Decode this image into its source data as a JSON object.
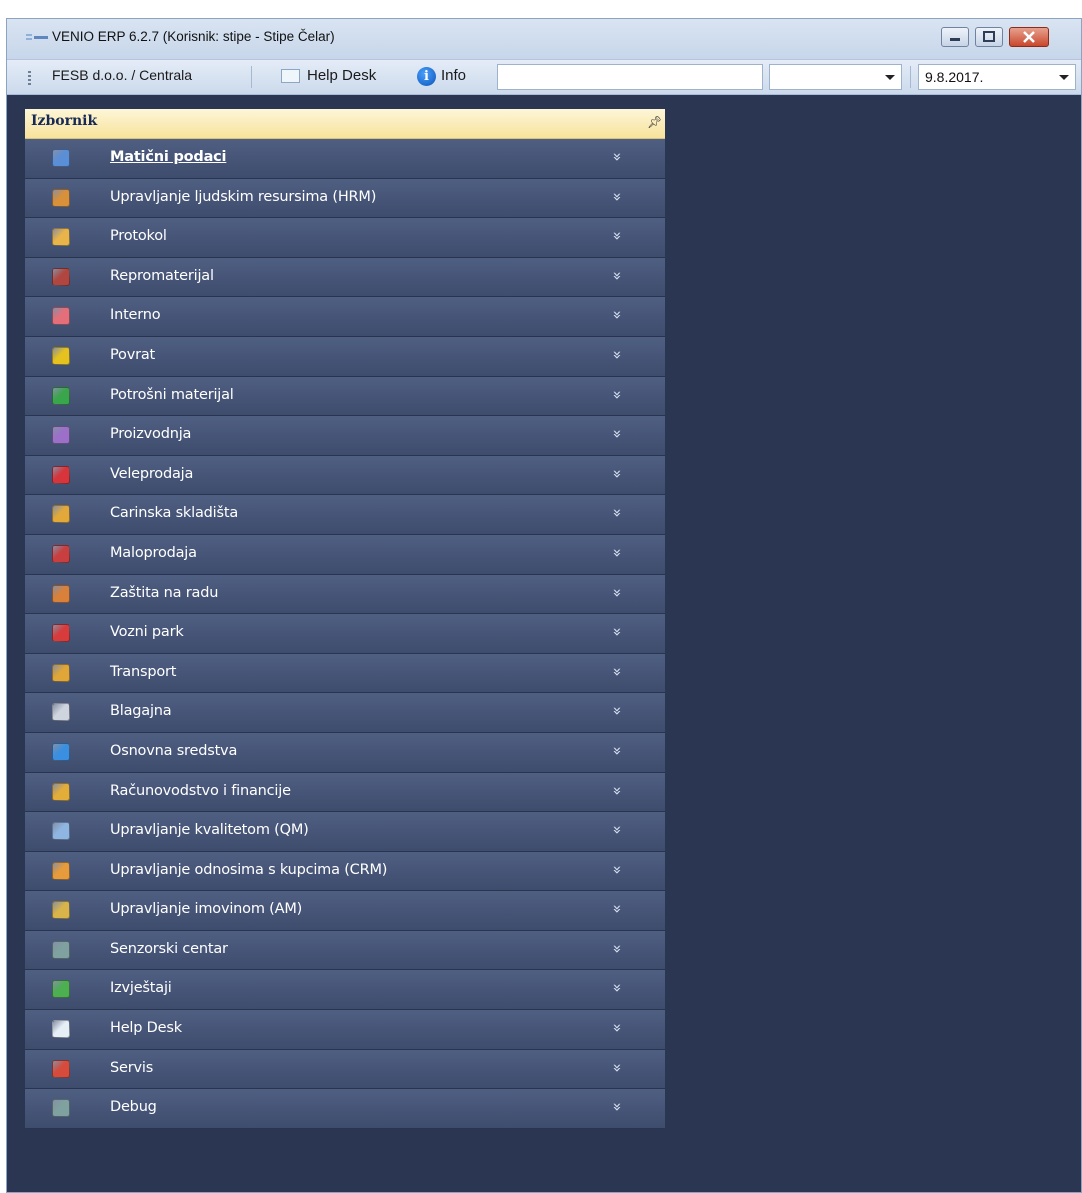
{
  "window": {
    "title": "VENIO ERP 6.2.7 (Korisnik: stipe - Stipe Čelar)"
  },
  "toolbar": {
    "company": "FESB d.o.o. / Centrala",
    "helpdesk_label": "Help Desk",
    "info_label": "Info",
    "search_value": "",
    "combo_value": "",
    "date_value": "9.8.2017."
  },
  "panel": {
    "title": "Izbornik",
    "items": [
      {
        "label": "Matični podaci",
        "icon": "database-icon",
        "color": "#5a8fd8"
      },
      {
        "label": "Upravljanje ljudskim resursima (HRM)",
        "icon": "person-icon",
        "color": "#d9903a"
      },
      {
        "label": "Protokol",
        "icon": "clipboard-icon",
        "color": "#e9b44a"
      },
      {
        "label": "Repromaterijal",
        "icon": "materials-icon",
        "color": "#b0463f"
      },
      {
        "label": "Interno",
        "icon": "document-icon",
        "color": "#e46f7a"
      },
      {
        "label": "Povrat",
        "icon": "radiation-icon",
        "color": "#e6c21f"
      },
      {
        "label": "Potrošni materijal",
        "icon": "share-icon",
        "color": "#3aa64b"
      },
      {
        "label": "Proizvodnja",
        "icon": "beaker-icon",
        "color": "#9c70c9"
      },
      {
        "label": "Veleprodaja",
        "icon": "store-icon",
        "color": "#d8343b"
      },
      {
        "label": "Carinska skladišta",
        "icon": "barrier-icon",
        "color": "#e2a93a"
      },
      {
        "label": "Maloprodaja",
        "icon": "cash-register-icon",
        "color": "#c93e3e"
      },
      {
        "label": "Zaštita na radu",
        "icon": "safety-icon",
        "color": "#d9803a"
      },
      {
        "label": "Vozni park",
        "icon": "car-icon",
        "color": "#d83b3b"
      },
      {
        "label": "Transport",
        "icon": "truck-icon",
        "color": "#e0a637"
      },
      {
        "label": "Blagajna",
        "icon": "register-icon",
        "color": "#cfd5de"
      },
      {
        "label": "Osnovna sredstva",
        "icon": "pie-chart-icon",
        "color": "#3b8fe0"
      },
      {
        "label": "Računovodstvo i financije",
        "icon": "calculator-icon",
        "color": "#e3ad3a"
      },
      {
        "label": "Upravljanje kvalitetom (QM)",
        "icon": "grid-icon",
        "color": "#8fb6e3"
      },
      {
        "label": "Upravljanje odnosima s kupcima (CRM)",
        "icon": "thumbs-up-icon",
        "color": "#e79b3a"
      },
      {
        "label": "Upravljanje imovinom (AM)",
        "icon": "assets-icon",
        "color": "#d9b44a"
      },
      {
        "label": "Senzorski centar",
        "icon": "monitor-icon",
        "color": "#7fa2a0"
      },
      {
        "label": "Izvještaji",
        "icon": "reports-icon",
        "color": "#4caf50"
      },
      {
        "label": "Help Desk",
        "icon": "helpdesk-icon",
        "color": "#e6eef6"
      },
      {
        "label": "Servis",
        "icon": "tools-icon",
        "color": "#d64b3b"
      },
      {
        "label": "Debug",
        "icon": "debug-monitor-icon",
        "color": "#7fa2a0"
      }
    ]
  }
}
